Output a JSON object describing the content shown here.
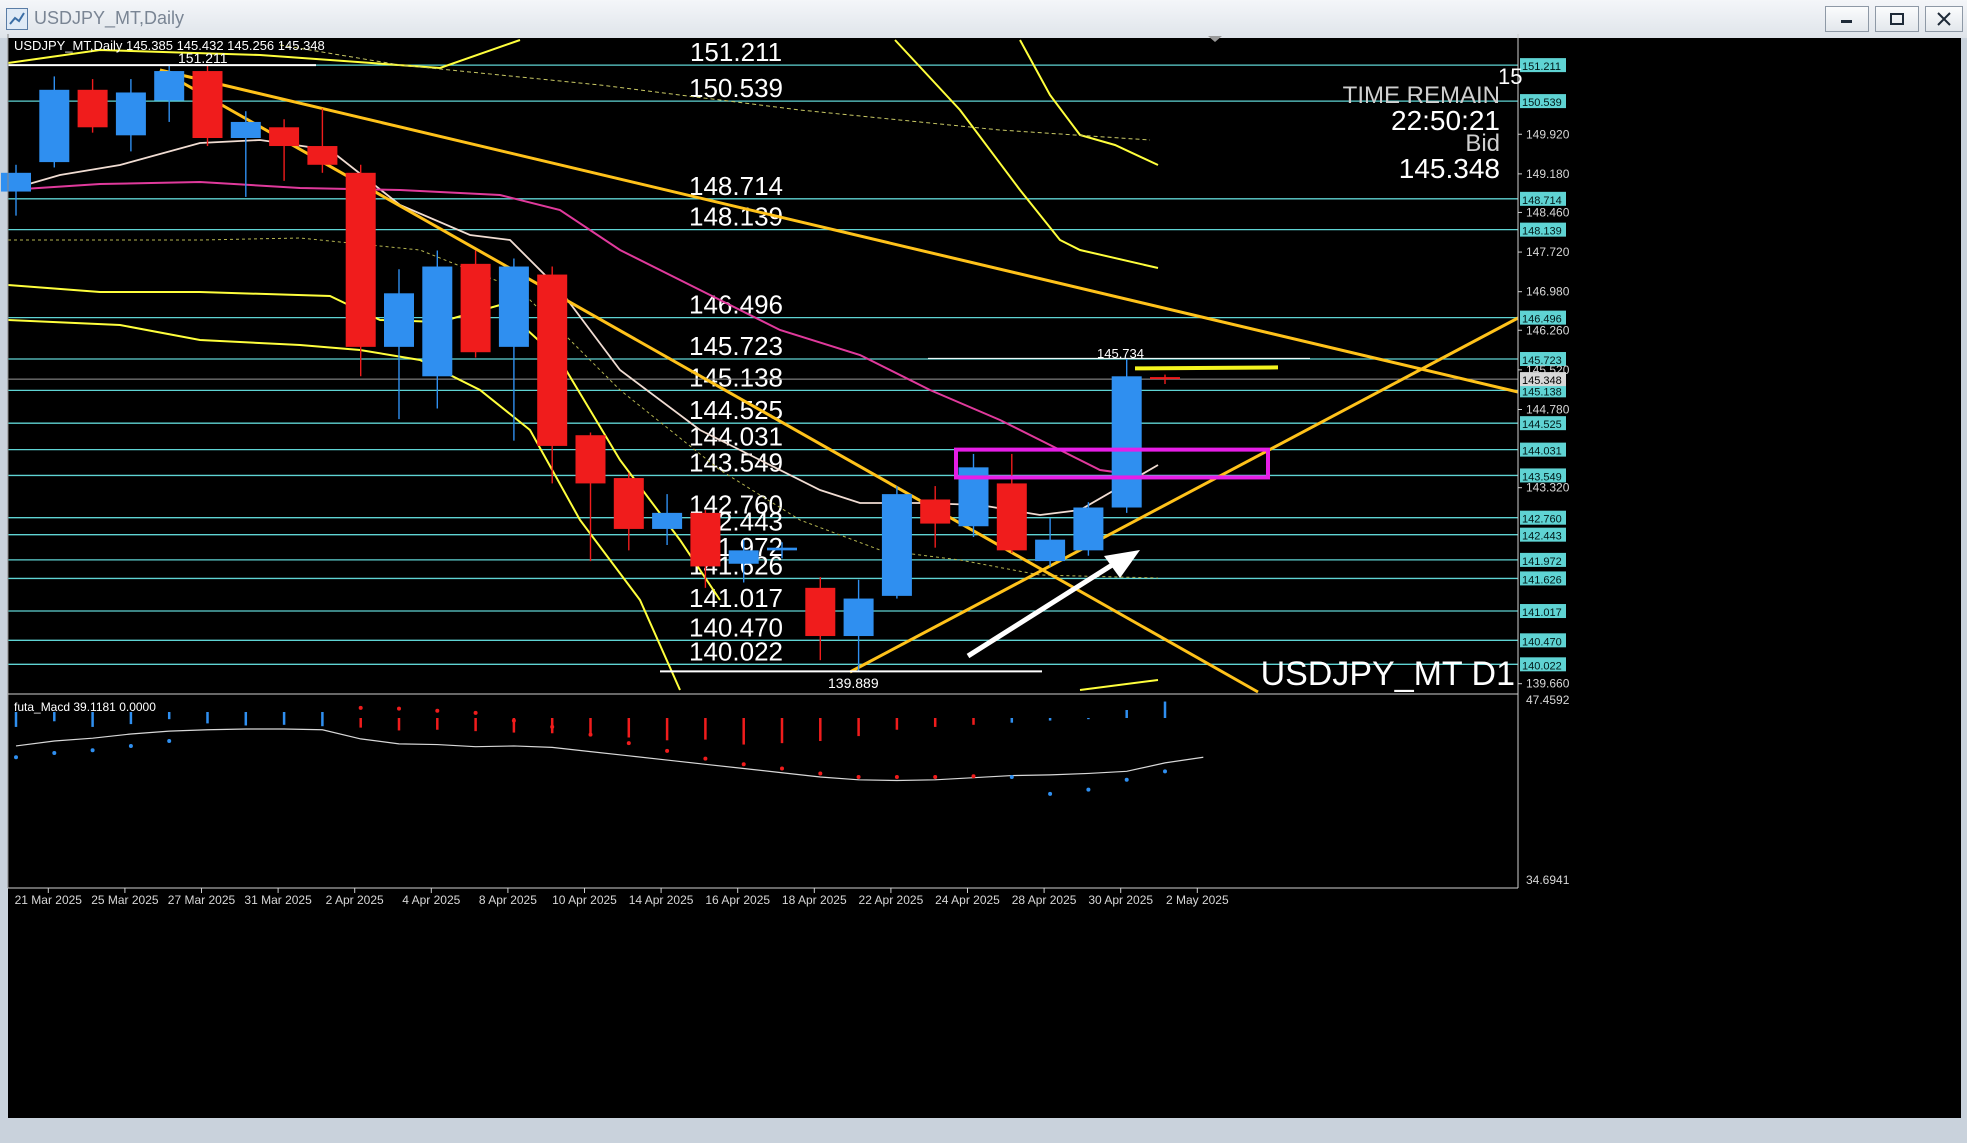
{
  "window": {
    "title": "USDJPY_MT,Daily",
    "buttons": [
      "minimize",
      "maximize",
      "close"
    ]
  },
  "colors": {
    "background": "#000000",
    "bull_candle": "#2f8ff0",
    "bear_candle": "#f01c1c",
    "level_line": "#5fd3d3",
    "trendline": "#ffc21a",
    "channel_band": "#ffff3c",
    "ma_fast": "#f0dcd2",
    "ma_mid": "#e03a9c",
    "box": "#e61ee6",
    "arrow": "#ffffff",
    "text": "#ffffff"
  },
  "chart_data": [
    {
      "type": "candlestick",
      "symbol_header": "USDJPY_MT,Daily  145.385 145.432 145.256 145.348",
      "timeframe_label": "USDJPY_MT D1",
      "x_ticks": [
        "21 Mar 2025",
        "25 Mar 2025",
        "27 Mar 2025",
        "31 Mar 2025",
        "2 Apr 2025",
        "4 Apr 2025",
        "8 Apr 2025",
        "10 Apr 2025",
        "14 Apr 2025",
        "16 Apr 2025",
        "18 Apr 2025",
        "22 Apr 2025",
        "24 Apr 2025",
        "28 Apr 2025",
        "30 Apr 2025",
        "2 May 2025"
      ],
      "ylim": [
        139.505,
        151.68
      ],
      "y_axis_labels": [
        "151.211",
        "150.539",
        "149.920",
        "149.180",
        "148.714",
        "148.460",
        "148.139",
        "147.720",
        "146.980",
        "146.496",
        "146.260",
        "145.723",
        "145.520",
        "145.348",
        "145.138",
        "144.780",
        "144.525",
        "144.031",
        "143.549",
        "143.320",
        "142.760",
        "142.443",
        "141.972",
        "141.626",
        "141.017",
        "140.470",
        "140.022",
        "139.660"
      ],
      "candles": [
        {
          "d": "20 Mar 2025",
          "o": 148.85,
          "h": 149.35,
          "l": 148.4,
          "c": 149.2
        },
        {
          "d": "21 Mar 2025",
          "o": 149.4,
          "h": 151.0,
          "l": 149.3,
          "c": 150.75
        },
        {
          "d": "24 Mar 2025",
          "o": 150.75,
          "h": 150.95,
          "l": 149.95,
          "c": 150.05
        },
        {
          "d": "25 Mar 2025",
          "o": 149.9,
          "h": 150.95,
          "l": 149.6,
          "c": 150.7
        },
        {
          "d": "26 Mar 2025",
          "o": 150.55,
          "h": 151.2,
          "l": 150.15,
          "c": 151.1
        },
        {
          "d": "27 Mar 2025",
          "o": 151.1,
          "h": 151.2,
          "l": 149.7,
          "c": 149.85
        },
        {
          "d": "28 Mar 2025",
          "o": 149.85,
          "h": 150.35,
          "l": 148.75,
          "c": 150.15
        },
        {
          "d": "31 Mar 2025",
          "o": 150.05,
          "h": 150.2,
          "l": 149.05,
          "c": 149.7
        },
        {
          "d": "1 Apr 2025",
          "o": 149.7,
          "h": 150.4,
          "l": 149.2,
          "c": 149.35
        },
        {
          "d": "2 Apr 2025",
          "o": 149.2,
          "h": 149.35,
          "l": 145.4,
          "c": 145.95
        },
        {
          "d": "3 Apr 2025",
          "o": 145.95,
          "h": 147.4,
          "l": 144.6,
          "c": 146.95
        },
        {
          "d": "4 Apr 2025",
          "o": 145.4,
          "h": 147.75,
          "l": 144.8,
          "c": 147.45
        },
        {
          "d": "7 Apr 2025",
          "o": 147.5,
          "h": 147.75,
          "l": 145.75,
          "c": 145.85
        },
        {
          "d": "8 Apr 2025",
          "o": 145.95,
          "h": 147.6,
          "l": 144.2,
          "c": 147.45
        },
        {
          "d": "9 Apr 2025",
          "o": 147.3,
          "h": 147.45,
          "l": 143.4,
          "c": 144.1
        },
        {
          "d": "10 Apr 2025",
          "o": 144.3,
          "h": 144.35,
          "l": 141.95,
          "c": 143.4
        },
        {
          "d": "11 Apr 2025",
          "o": 143.5,
          "h": 143.6,
          "l": 142.15,
          "c": 142.55
        },
        {
          "d": "14 Apr 2025",
          "o": 142.55,
          "h": 143.2,
          "l": 142.25,
          "c": 142.85
        },
        {
          "d": "15 Apr 2025",
          "o": 142.85,
          "h": 142.9,
          "l": 141.45,
          "c": 141.85
        },
        {
          "d": "16 Apr 2025",
          "o": 141.9,
          "h": 142.35,
          "l": 141.55,
          "c": 142.15
        },
        {
          "d": "17 Apr 2025",
          "o": 142.15,
          "h": 142.3,
          "l": 142.0,
          "c": 142.2
        },
        {
          "d": "18 Apr 2025",
          "o": 141.45,
          "h": 141.65,
          "l": 140.1,
          "c": 140.55
        },
        {
          "d": "21 Apr 2025",
          "o": 140.55,
          "h": 141.6,
          "l": 139.89,
          "c": 141.25
        },
        {
          "d": "22 Apr 2025",
          "o": 141.3,
          "h": 143.35,
          "l": 141.25,
          "c": 143.2
        },
        {
          "d": "23 Apr 2025",
          "o": 143.1,
          "h": 143.35,
          "l": 142.2,
          "c": 142.65
        },
        {
          "d": "24 Apr 2025",
          "o": 142.6,
          "h": 143.95,
          "l": 142.4,
          "c": 143.7
        },
        {
          "d": "25 Apr 2025",
          "o": 143.4,
          "h": 143.95,
          "l": 142.1,
          "c": 142.15
        },
        {
          "d": "28 Apr 2025",
          "o": 141.95,
          "h": 142.75,
          "l": 141.85,
          "c": 142.35
        },
        {
          "d": "29 Apr 2025",
          "o": 142.15,
          "h": 143.05,
          "l": 142.05,
          "c": 142.95
        },
        {
          "d": "30 Apr 2025",
          "o": 142.95,
          "h": 145.734,
          "l": 142.85,
          "c": 145.4
        },
        {
          "d": "1 May 2025",
          "o": 145.385,
          "h": 145.432,
          "l": 145.256,
          "c": 145.348
        }
      ],
      "levels": [
        151.211,
        150.539,
        148.714,
        148.139,
        146.496,
        145.723,
        145.138,
        144.525,
        144.031,
        143.549,
        142.76,
        142.443,
        141.972,
        141.626,
        141.017,
        140.47,
        140.022
      ],
      "annotations": {
        "high_label": "151.211",
        "recent_high": "145.734",
        "low_label": "139.889"
      },
      "info": {
        "time_remain_label": "TIME REMAIN",
        "time_remain": "22:50:21",
        "bid_label": "Bid",
        "bid": "145.348",
        "corner_mark": "15"
      },
      "current_price": 145.348
    },
    {
      "type": "macd_histogram",
      "label": "futa_Macd 39.1181  0.0000",
      "ylim": [
        34.6941,
        47.4592
      ],
      "y_axis_labels": [
        "47.4592",
        "34.6941"
      ],
      "histogram": [
        {
          "d": "20 Mar 2025",
          "v": 45.55
        },
        {
          "d": "21 Mar 2025",
          "v": 45.95
        },
        {
          "d": "24 Mar 2025",
          "v": 45.55
        },
        {
          "d": "25 Mar 2025",
          "v": 45.75
        },
        {
          "d": "26 Mar 2025",
          "v": 46.1
        },
        {
          "d": "27 Mar 2025",
          "v": 45.8
        },
        {
          "d": "28 Mar 2025",
          "v": 45.65
        },
        {
          "d": "31 Mar 2025",
          "v": 45.7
        },
        {
          "d": "1 Apr 2025",
          "v": 45.6
        },
        {
          "d": "2 Apr 2025",
          "v": 45.5
        },
        {
          "d": "3 Apr 2025",
          "v": 45.3
        },
        {
          "d": "4 Apr 2025",
          "v": 45.35
        },
        {
          "d": "7 Apr 2025",
          "v": 45.25
        },
        {
          "d": "8 Apr 2025",
          "v": 45.15
        },
        {
          "d": "9 Apr 2025",
          "v": 45.1
        },
        {
          "d": "10 Apr 2025",
          "v": 44.9
        },
        {
          "d": "11 Apr 2025",
          "v": 44.8
        },
        {
          "d": "14 Apr 2025",
          "v": 44.6
        },
        {
          "d": "15 Apr 2025",
          "v": 44.65
        },
        {
          "d": "16 Apr 2025",
          "v": 44.3
        },
        {
          "d": "17 Apr 2025",
          "v": 44.4
        },
        {
          "d": "18 Apr 2025",
          "v": 44.55
        },
        {
          "d": "21 Apr 2025",
          "v": 44.9
        },
        {
          "d": "22 Apr 2025",
          "v": 45.35
        },
        {
          "d": "23 Apr 2025",
          "v": 45.55
        },
        {
          "d": "24 Apr 2025",
          "v": 45.7
        },
        {
          "d": "25 Apr 2025",
          "v": 45.85
        },
        {
          "d": "28 Apr 2025",
          "v": 46.0
        },
        {
          "d": "29 Apr 2025",
          "v": 46.1
        },
        {
          "d": "30 Apr 2025",
          "v": 46.75
        },
        {
          "d": "1 May 2025",
          "v": 47.35
        }
      ],
      "signal_line": [
        44.2,
        44.55,
        44.75,
        45.05,
        45.25,
        45.35,
        45.4,
        45.4,
        45.35,
        44.7,
        44.35,
        44.3,
        44.15,
        44.2,
        44.1,
        43.8,
        43.5,
        43.2,
        42.9,
        42.6,
        42.3,
        42.0,
        41.8,
        41.75,
        41.8,
        41.95,
        42.1,
        42.15,
        42.25,
        42.4,
        43.0,
        43.4
      ],
      "signal_dots": [
        {
          "d": "20 Mar 2025",
          "v": 43.4
        },
        {
          "d": "21 Mar 2025",
          "v": 43.7
        },
        {
          "d": "24 Mar 2025",
          "v": 43.9
        },
        {
          "d": "25 Mar 2025",
          "v": 44.2
        },
        {
          "d": "26 Mar 2025",
          "v": 44.55
        },
        {
          "d": "2 Apr 2025",
          "v": 46.9
        },
        {
          "d": "3 Apr 2025",
          "v": 46.85
        },
        {
          "d": "4 Apr 2025",
          "v": 46.7
        },
        {
          "d": "7 Apr 2025",
          "v": 46.55
        },
        {
          "d": "8 Apr 2025",
          "v": 46.0
        },
        {
          "d": "9 Apr 2025",
          "v": 45.55
        },
        {
          "d": "10 Apr 2025",
          "v": 45.0
        },
        {
          "d": "11 Apr 2025",
          "v": 44.4
        },
        {
          "d": "14 Apr 2025",
          "v": 43.85
        },
        {
          "d": "15 Apr 2025",
          "v": 43.3
        },
        {
          "d": "16 Apr 2025",
          "v": 42.9
        },
        {
          "d": "17 Apr 2025",
          "v": 42.6
        },
        {
          "d": "18 Apr 2025",
          "v": 42.25
        },
        {
          "d": "21 Apr 2025",
          "v": 42.0
        },
        {
          "d": "22 Apr 2025",
          "v": 42.0
        },
        {
          "d": "23 Apr 2025",
          "v": 42.0
        },
        {
          "d": "24 Apr 2025",
          "v": 42.05
        },
        {
          "d": "25 Apr 2025",
          "v": 42.0
        },
        {
          "d": "28 Apr 2025",
          "v": 40.8
        },
        {
          "d": "29 Apr 2025",
          "v": 41.1
        },
        {
          "d": "30 Apr 2025",
          "v": 41.8
        },
        {
          "d": "1 May 2025",
          "v": 42.4
        }
      ]
    }
  ]
}
